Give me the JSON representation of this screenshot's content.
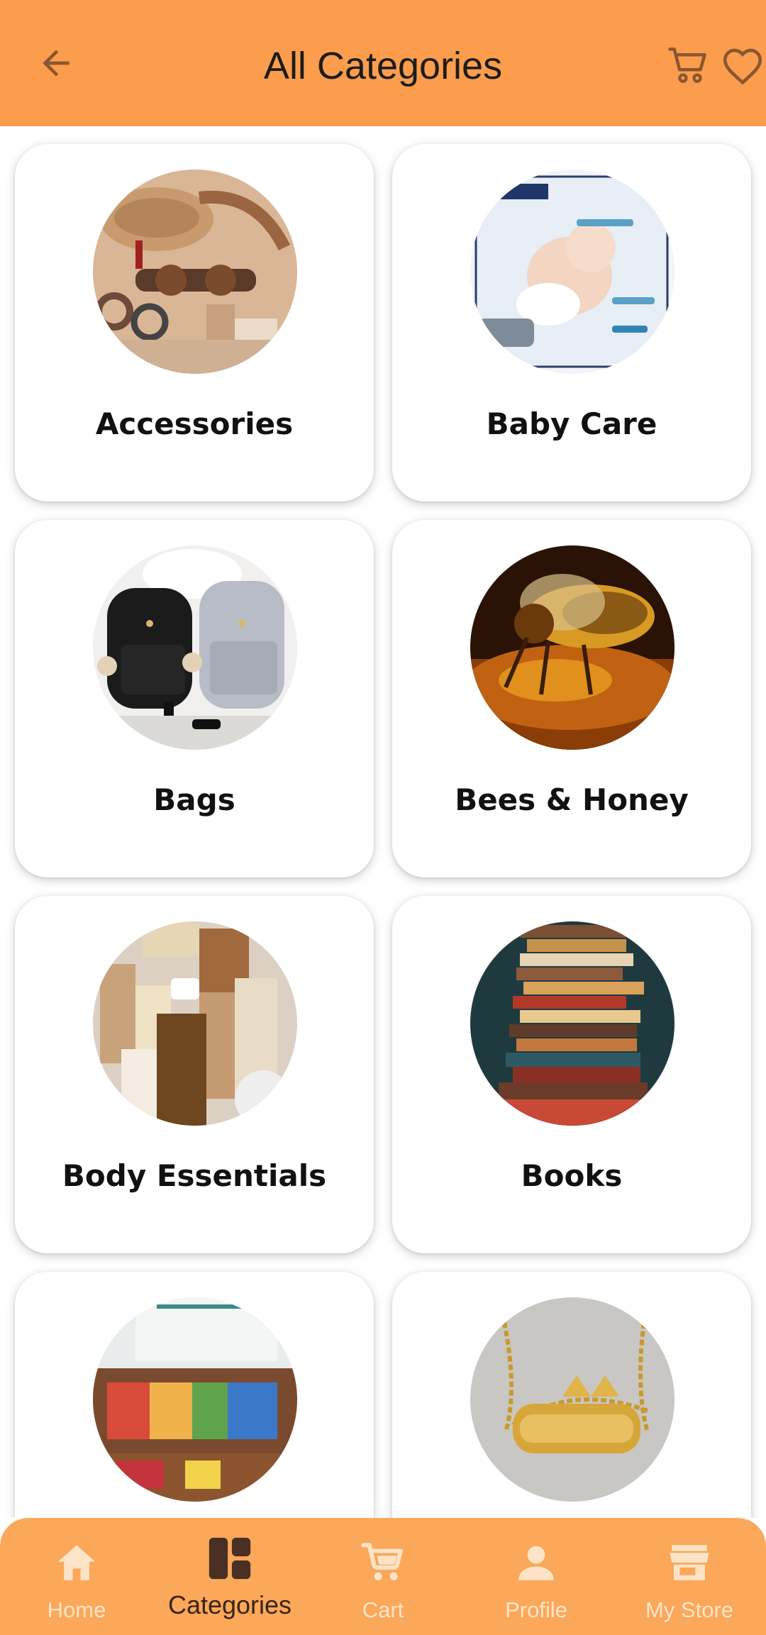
{
  "header": {
    "title": "All Categories",
    "back_icon": "arrow-left-icon",
    "cart_icon": "cart-icon",
    "wishlist_icon": "heart-icon",
    "background": "#fb9d4c"
  },
  "categories": [
    {
      "label": "Accessories"
    },
    {
      "label": "Baby Care"
    },
    {
      "label": "Bags"
    },
    {
      "label": "Bees & Honey"
    },
    {
      "label": "Body Essentials"
    },
    {
      "label": "Books"
    },
    {
      "label": ""
    },
    {
      "label": ""
    }
  ],
  "bottom_nav": {
    "items": [
      {
        "label": "Home",
        "icon": "home-icon"
      },
      {
        "label": "Categories",
        "icon": "categories-icon",
        "active": true
      },
      {
        "label": "Cart",
        "icon": "cart-icon"
      },
      {
        "label": "Profile",
        "icon": "profile-icon"
      },
      {
        "label": "My Store",
        "icon": "store-icon"
      }
    ],
    "background": "#fba85a"
  }
}
